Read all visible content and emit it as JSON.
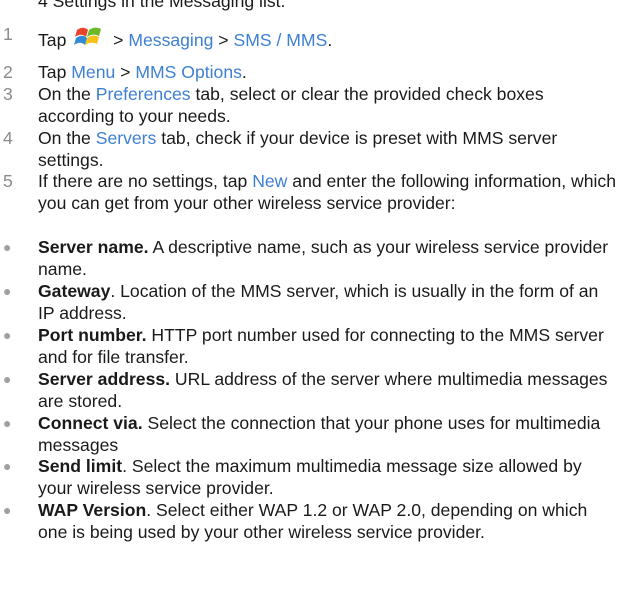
{
  "header_partial": "4  Settings in the Messaging list.",
  "steps": [
    {
      "num": "1",
      "tap": "Tap",
      "sep1": " > ",
      "link1": "Messaging",
      "sep2": " > ",
      "link2": "SMS / MMS",
      "end": "."
    },
    {
      "num": "2",
      "pre": "Tap ",
      "link1": "Menu",
      "sep": " > ",
      "link2": "MMS Options",
      "end": "."
    },
    {
      "num": "3",
      "pre": "On the ",
      "link": "Preferences",
      "post": " tab, select or clear the provided check boxes according to your needs."
    },
    {
      "num": "4",
      "pre": "On the ",
      "link": "Servers",
      "post": " tab, check if your device is preset with MMS server settings."
    },
    {
      "num": "5",
      "pre": "If there are no settings, tap ",
      "link": "New",
      "post": " and enter the following information, which you can get from your other wireless service provider:"
    }
  ],
  "bullets": [
    {
      "term": "Server name.",
      "desc": " A descriptive name, such as your wireless service provider name."
    },
    {
      "term": "Gateway",
      "desc": ". Location of the MMS server, which is usually in the form of an IP address."
    },
    {
      "term": "Port number.",
      "desc": " HTTP port number used for connecting to the MMS server and for file transfer."
    },
    {
      "term": "Server address.",
      "desc": " URL address of the server where multimedia messages are stored."
    },
    {
      "term": "Connect via.",
      "desc": " Select the connection that your phone uses for multimedia messages"
    },
    {
      "term": "Send limit",
      "desc": ". Select the maximum multimedia message size allowed by your wireless service provider."
    },
    {
      "term": "WAP Version",
      "desc": ". Select either WAP 1.2 or WAP 2.0, depending on which one is being used by your other wireless service provider."
    }
  ],
  "colors": {
    "link": "#3d7fd1",
    "bullet": "#a0a0a0",
    "number": "#8a8a8a"
  }
}
